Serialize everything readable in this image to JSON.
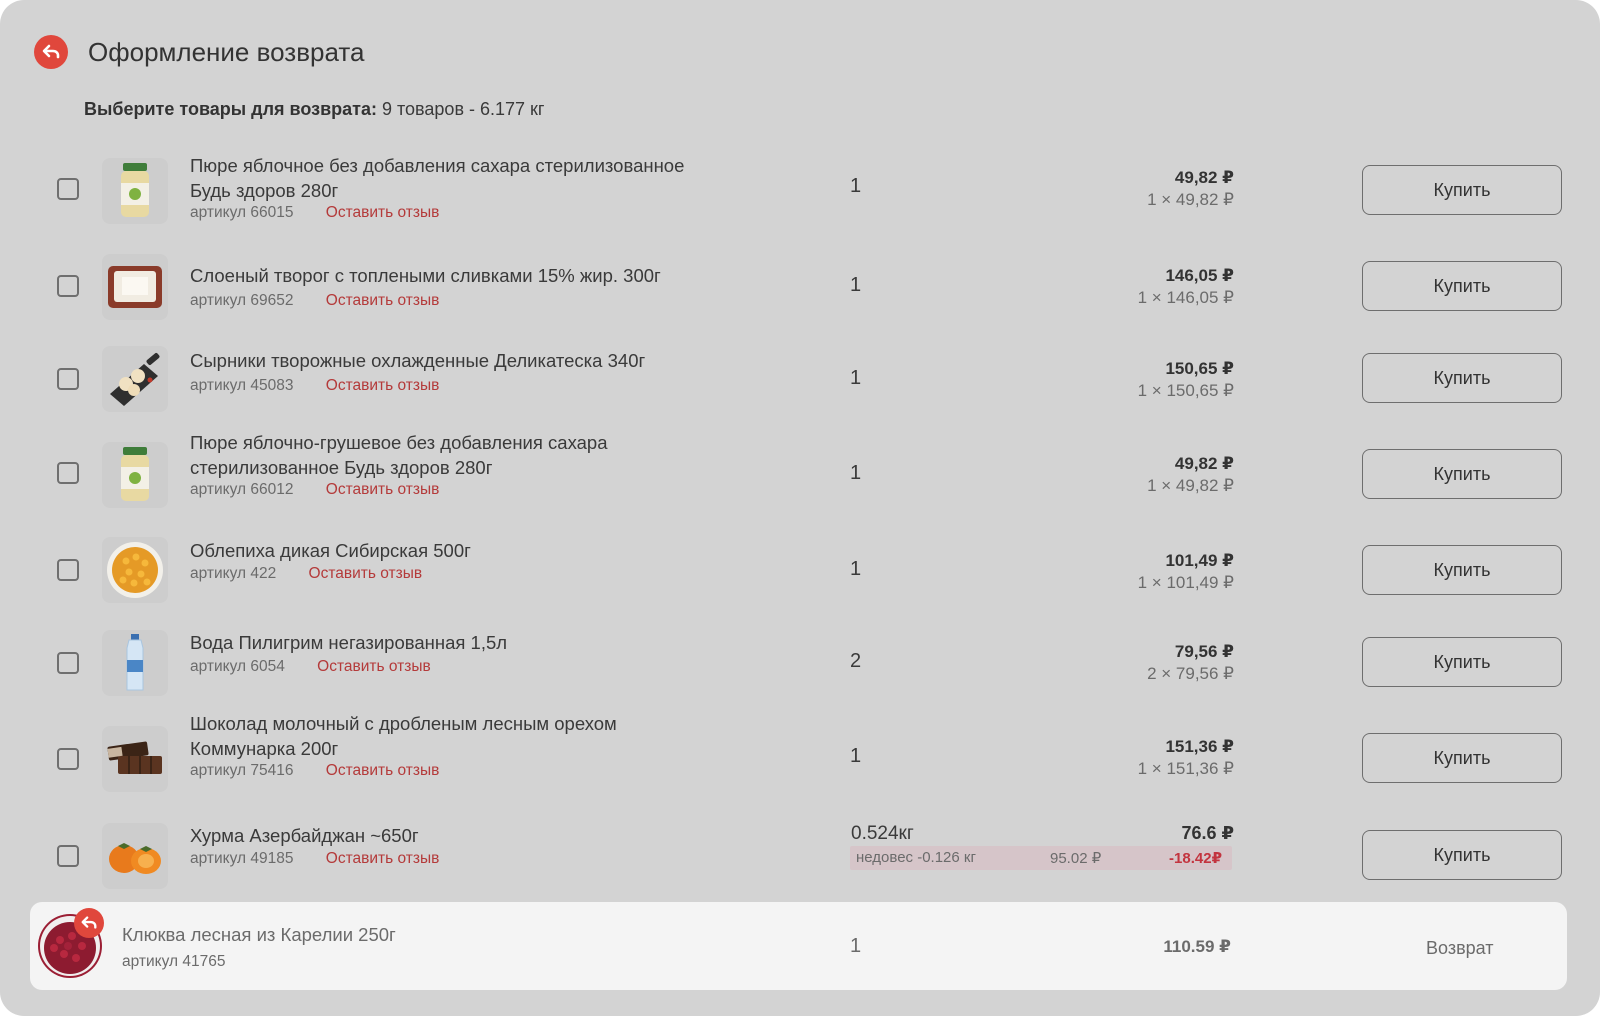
{
  "header": {
    "title": "Оформление возврата",
    "back_icon": "undo-arrow-icon",
    "accent_color": "#e0473c"
  },
  "selection": {
    "label": "Выберите товары для возврата:",
    "summary": "9 товаров - 6.177 кг"
  },
  "review_label": "Оставить отзыв",
  "buy_label": "Купить",
  "items": [
    {
      "name_line1": "Пюре яблочное без добавления сахара стерилизованное",
      "name_line2": "Будь здоров 280г",
      "article": "артикул 66015",
      "qty": "1",
      "price": "49,82 ₽",
      "unit_price": "1 × 49,82 ₽",
      "image": "jar-puree"
    },
    {
      "name_line1": "Слоеный творог с топлеными сливками 15% жир. 300г",
      "name_line2": "",
      "article": "артикул 69652",
      "qty": "1",
      "price": "146,05 ₽",
      "unit_price": "1 × 146,05 ₽",
      "image": "cheese-box"
    },
    {
      "name_line1": "Сырники творожные охлажденные Деликатеска 340г",
      "name_line2": "",
      "article": "артикул 45083",
      "qty": "1",
      "price": "150,65 ₽",
      "unit_price": "1 × 150,65 ₽",
      "image": "syrniki-board"
    },
    {
      "name_line1": "Пюре яблочно-грушевое без добавления сахара",
      "name_line2": "стерилизованное Будь здоров 280г",
      "article": "артикул 66012",
      "qty": "1",
      "price": "49,82 ₽",
      "unit_price": "1 × 49,82 ₽",
      "image": "jar-puree"
    },
    {
      "name_line1": "Облепиха дикая Сибирская 500г",
      "name_line2": "",
      "article": "артикул 422",
      "qty": "1",
      "price": "101,49 ₽",
      "unit_price": "1 × 101,49 ₽",
      "image": "sea-buckthorn-bowl"
    },
    {
      "name_line1": "Вода Пилигрим негазированная 1,5л",
      "name_line2": "",
      "article": "артикул 6054",
      "qty": "2",
      "price": "79,56 ₽",
      "unit_price": "2 × 79,56 ₽",
      "image": "water-bottle"
    },
    {
      "name_line1": "Шоколад молочный с дробленым лесным орехом",
      "name_line2": "Коммунарка 200г",
      "article": "артикул 75416",
      "qty": "1",
      "price": "151,36 ₽",
      "unit_price": "1 × 151,36 ₽",
      "image": "chocolate-bar"
    },
    {
      "name_line1": "Хурма Азербайджан ~650г",
      "name_line2": "",
      "article": "артикул 49185",
      "qty": "0.524кг",
      "price": "76.6 ₽",
      "unit_price": "",
      "image": "persimmon",
      "underweight": {
        "label": "недовес -0.126 кг",
        "original": "95.02 ₽",
        "diff": "-18.42₽"
      }
    }
  ],
  "returned_item": {
    "name": "Клюква лесная из Карелии 250г",
    "article": "артикул 41765",
    "qty": "1",
    "price": "110.59 ₽",
    "status": "Возврат",
    "image": "cranberry-bowl"
  }
}
